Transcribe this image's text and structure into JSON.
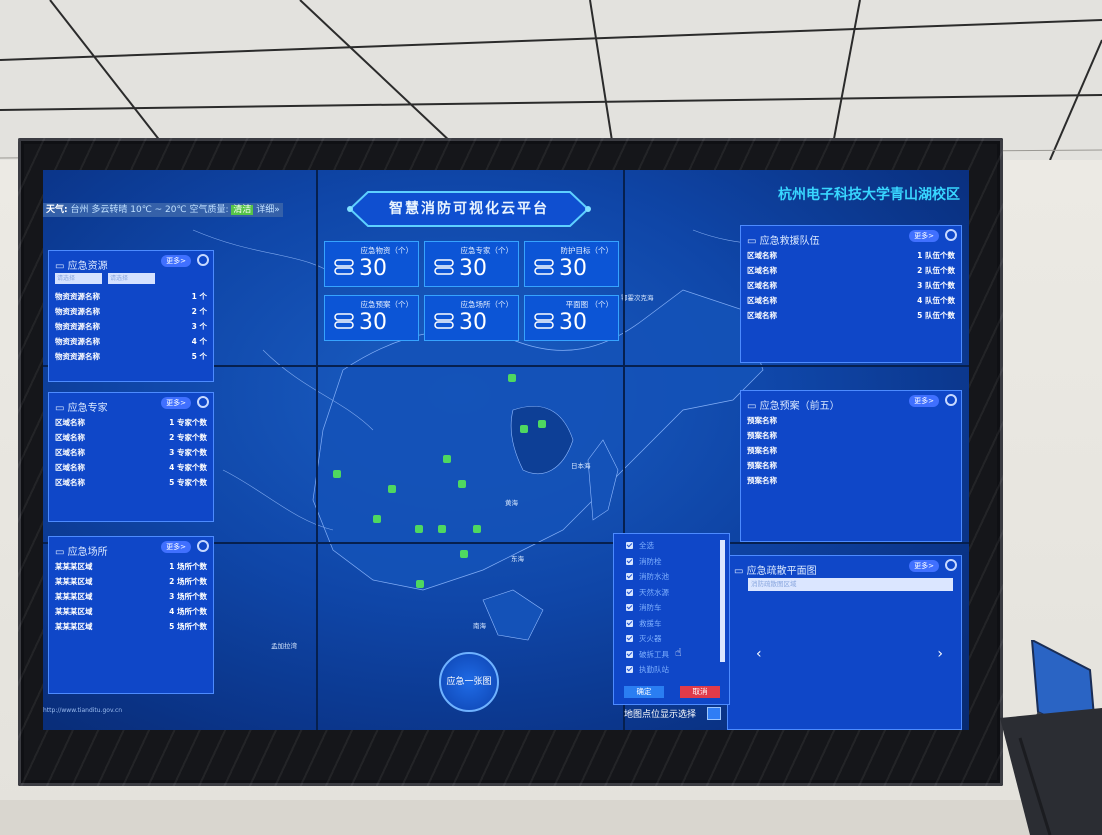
{
  "weather": {
    "location": "台州",
    "text": "多云转晴 10℃ ~ 20℃ 空气质量:",
    "quality": "清洁",
    "suffix": "详细»"
  },
  "title": "智慧消防可视化云平台",
  "campus": "杭州电子科技大学青山湖校区",
  "stats": [
    {
      "label": "应急物资（个）",
      "value": "30"
    },
    {
      "label": "应急专家（个）",
      "value": "30"
    },
    {
      "label": "防护目标（个）",
      "value": "30"
    },
    {
      "label": "应急预案（个）",
      "value": "30"
    },
    {
      "label": "应急场所（个）",
      "value": "30"
    },
    {
      "label": "平面图 （个）",
      "value": "30"
    }
  ],
  "more_label": "更多>",
  "resources": {
    "title": "应急资源",
    "select1": "请选择",
    "select2": "请选择",
    "rows": [
      {
        "name": "物资资源名称",
        "count": "1 个"
      },
      {
        "name": "物资资源名称",
        "count": "2 个"
      },
      {
        "name": "物资资源名称",
        "count": "3 个"
      },
      {
        "name": "物资资源名称",
        "count": "4 个"
      },
      {
        "name": "物资资源名称",
        "count": "5 个"
      }
    ]
  },
  "experts": {
    "title": "应急专家",
    "rows": [
      {
        "name": "区域名称",
        "count": "1 专家个数"
      },
      {
        "name": "区域名称",
        "count": "2 专家个数"
      },
      {
        "name": "区域名称",
        "count": "3 专家个数"
      },
      {
        "name": "区域名称",
        "count": "4 专家个数"
      },
      {
        "name": "区域名称",
        "count": "5 专家个数"
      }
    ]
  },
  "places": {
    "title": "应急场所",
    "rows": [
      {
        "name": "某某某区域",
        "count": "1 场所个数"
      },
      {
        "name": "某某某区域",
        "count": "2 场所个数"
      },
      {
        "name": "某某某区域",
        "count": "3 场所个数"
      },
      {
        "name": "某某某区域",
        "count": "4 场所个数"
      },
      {
        "name": "某某某区域",
        "count": "5 场所个数"
      }
    ]
  },
  "rescue": {
    "title": "应急救援队伍",
    "rows": [
      {
        "name": "区域名称",
        "count": "1 队伍个数"
      },
      {
        "name": "区域名称",
        "count": "2 队伍个数"
      },
      {
        "name": "区域名称",
        "count": "3 队伍个数"
      },
      {
        "name": "区域名称",
        "count": "4 队伍个数"
      },
      {
        "name": "区域名称",
        "count": "5 队伍个数"
      }
    ]
  },
  "plans": {
    "title": "应急预案（前五）",
    "rows": [
      "预案名称",
      "预案名称",
      "预案名称",
      "预案名称",
      "预案名称"
    ]
  },
  "evacuation": {
    "title": "应急疏散平面图",
    "select": "消防疏散图区域",
    "prev": "‹",
    "next": "›"
  },
  "layers": {
    "items": [
      "全选",
      "消防栓",
      "消防水池",
      "天然水源",
      "消防车",
      "救援车",
      "灭火器",
      "破拆工具",
      "执勤队站"
    ],
    "confirm": "确定",
    "cancel": "取消",
    "caption": "地图点位显示选择"
  },
  "one_map_button": "应急一张图",
  "map_labels": {
    "sea1": "鄂霍次克海",
    "sea2": "日本海",
    "sea3": "黄海",
    "sea4": "东海",
    "sea5": "南海",
    "country": "孟加拉湾"
  },
  "footer": "http://www.tianditu.gov.cn"
}
